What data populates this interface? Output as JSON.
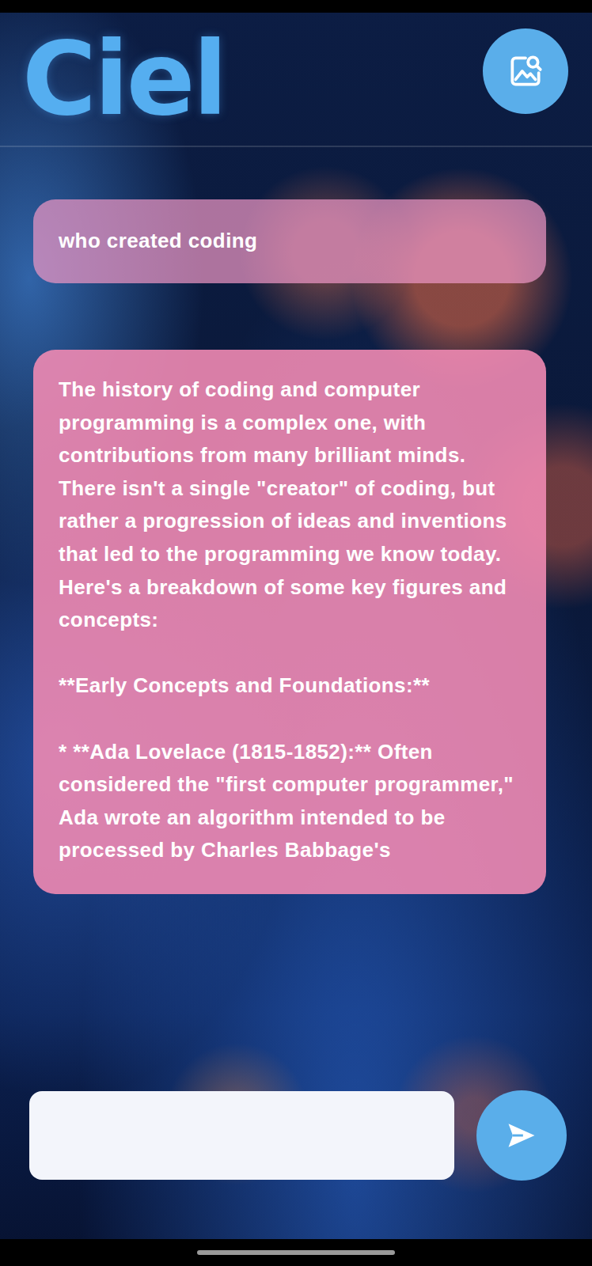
{
  "app": {
    "title": "Ciel"
  },
  "messages": [
    {
      "kind": "user",
      "text": "who created coding"
    },
    {
      "kind": "assistant",
      "text": "The history of coding and computer programming is a complex one, with contributions from many brilliant minds. There isn't a single \"creator\" of coding, but rather a progression of ideas and inventions that led to the programming we know today. Here's a breakdown of some key figures and concepts:\n\n**Early Concepts and Foundations:**\n\n* **Ada Lovelace (1815-1852):** Often considered the \"first computer programmer,\" Ada wrote an algorithm intended to be processed by Charles Babbage's"
    }
  ],
  "input": {
    "value": ""
  }
}
